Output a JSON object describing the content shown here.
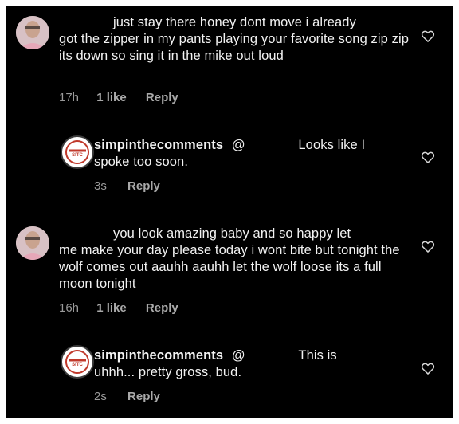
{
  "comments": [
    {
      "text_line1": "just stay there honey dont move i already",
      "text_rest": "got the zipper in  my pants playing your favorite song zip zip its down so sing it in the mike out loud",
      "time": "17h",
      "likes": "1 like",
      "reply": "Reply"
    },
    {
      "username": "simpinthecomments",
      "mention": "@",
      "text_line1": "Looks like I",
      "text_rest": "spoke too soon.",
      "time": "3s",
      "reply": "Reply",
      "logo_text": "SITC"
    },
    {
      "text_line1": "you look amazing baby and so happy let",
      "text_rest": "me make your day please today i wont bite but tonight the wolf comes out aauhh aauhh let  the wolf loose its a full moon tonight",
      "time": "16h",
      "likes": "1 like",
      "reply": "Reply"
    },
    {
      "username": "simpinthecomments",
      "mention": "@",
      "text_line1": "This is",
      "text_rest": "uhhh... pretty gross, bud.",
      "time": "2s",
      "reply": "Reply",
      "logo_text": "SITC"
    }
  ],
  "colors": {
    "background": "#000000",
    "text": "#f2f2f2",
    "meta": "#9a9a9a",
    "border": "#ffffff"
  }
}
